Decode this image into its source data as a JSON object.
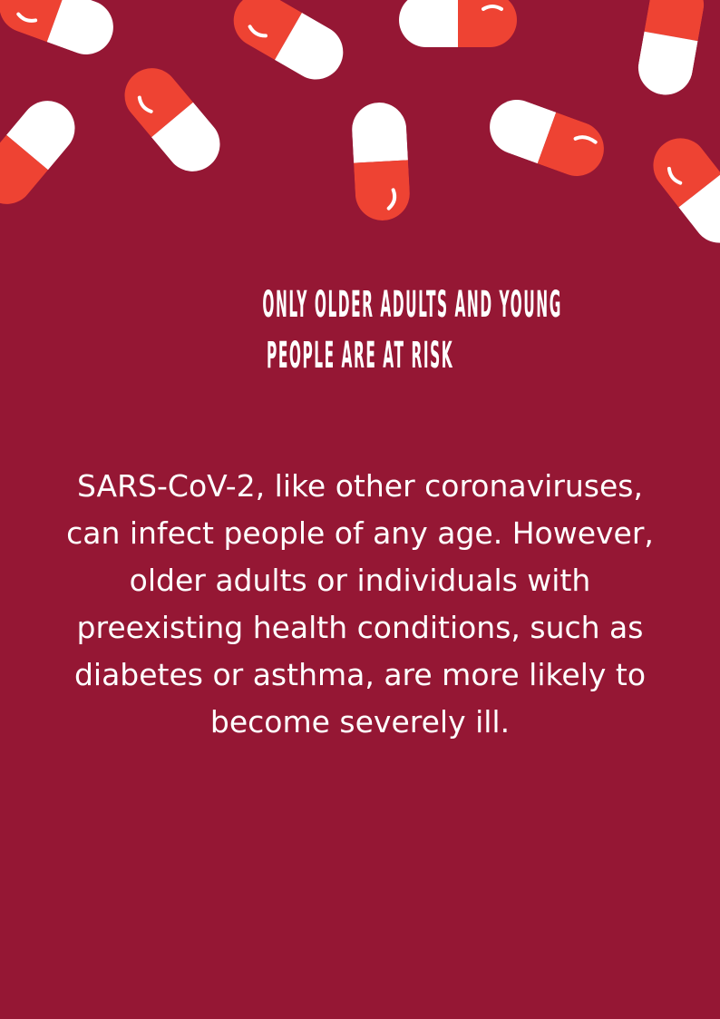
{
  "colors": {
    "background": "#951734",
    "pill_red": "#ee4333",
    "pill_white": "#ffffff",
    "text": "#ffffff"
  },
  "decoration": {
    "icon": "capsule-pill-icon"
  },
  "heading": {
    "line1": "ONLY OLDER ADULTS AND YOUNG",
    "line2": "PEOPLE ARE AT RISK"
  },
  "body": {
    "text": "SARS-CoV-2, like other coronaviruses, can infect people of any age. However, older adults or individuals with preexisting health conditions, such as diabetes or asthma, are more likely to become severely ill."
  }
}
